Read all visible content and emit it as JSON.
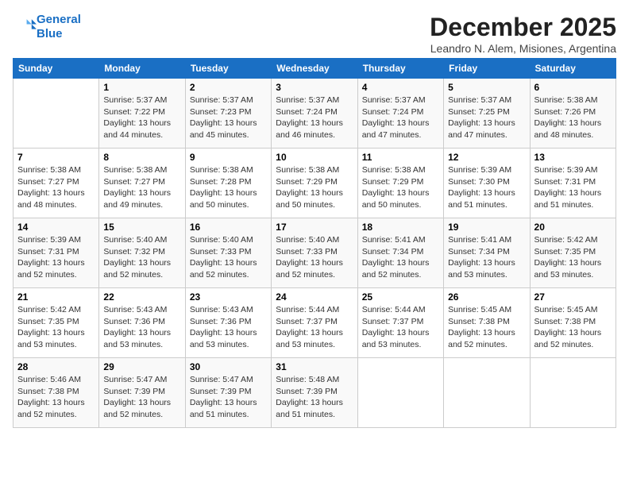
{
  "header": {
    "logo_line1": "General",
    "logo_line2": "Blue",
    "month": "December 2025",
    "location": "Leandro N. Alem, Misiones, Argentina"
  },
  "days_of_week": [
    "Sunday",
    "Monday",
    "Tuesday",
    "Wednesday",
    "Thursday",
    "Friday",
    "Saturday"
  ],
  "weeks": [
    [
      {
        "day": "",
        "content": ""
      },
      {
        "day": "1",
        "content": "Sunrise: 5:37 AM\nSunset: 7:22 PM\nDaylight: 13 hours\nand 44 minutes."
      },
      {
        "day": "2",
        "content": "Sunrise: 5:37 AM\nSunset: 7:23 PM\nDaylight: 13 hours\nand 45 minutes."
      },
      {
        "day": "3",
        "content": "Sunrise: 5:37 AM\nSunset: 7:24 PM\nDaylight: 13 hours\nand 46 minutes."
      },
      {
        "day": "4",
        "content": "Sunrise: 5:37 AM\nSunset: 7:24 PM\nDaylight: 13 hours\nand 47 minutes."
      },
      {
        "day": "5",
        "content": "Sunrise: 5:37 AM\nSunset: 7:25 PM\nDaylight: 13 hours\nand 47 minutes."
      },
      {
        "day": "6",
        "content": "Sunrise: 5:38 AM\nSunset: 7:26 PM\nDaylight: 13 hours\nand 48 minutes."
      }
    ],
    [
      {
        "day": "7",
        "content": "Sunrise: 5:38 AM\nSunset: 7:27 PM\nDaylight: 13 hours\nand 48 minutes."
      },
      {
        "day": "8",
        "content": "Sunrise: 5:38 AM\nSunset: 7:27 PM\nDaylight: 13 hours\nand 49 minutes."
      },
      {
        "day": "9",
        "content": "Sunrise: 5:38 AM\nSunset: 7:28 PM\nDaylight: 13 hours\nand 50 minutes."
      },
      {
        "day": "10",
        "content": "Sunrise: 5:38 AM\nSunset: 7:29 PM\nDaylight: 13 hours\nand 50 minutes."
      },
      {
        "day": "11",
        "content": "Sunrise: 5:38 AM\nSunset: 7:29 PM\nDaylight: 13 hours\nand 50 minutes."
      },
      {
        "day": "12",
        "content": "Sunrise: 5:39 AM\nSunset: 7:30 PM\nDaylight: 13 hours\nand 51 minutes."
      },
      {
        "day": "13",
        "content": "Sunrise: 5:39 AM\nSunset: 7:31 PM\nDaylight: 13 hours\nand 51 minutes."
      }
    ],
    [
      {
        "day": "14",
        "content": "Sunrise: 5:39 AM\nSunset: 7:31 PM\nDaylight: 13 hours\nand 52 minutes."
      },
      {
        "day": "15",
        "content": "Sunrise: 5:40 AM\nSunset: 7:32 PM\nDaylight: 13 hours\nand 52 minutes."
      },
      {
        "day": "16",
        "content": "Sunrise: 5:40 AM\nSunset: 7:33 PM\nDaylight: 13 hours\nand 52 minutes."
      },
      {
        "day": "17",
        "content": "Sunrise: 5:40 AM\nSunset: 7:33 PM\nDaylight: 13 hours\nand 52 minutes."
      },
      {
        "day": "18",
        "content": "Sunrise: 5:41 AM\nSunset: 7:34 PM\nDaylight: 13 hours\nand 52 minutes."
      },
      {
        "day": "19",
        "content": "Sunrise: 5:41 AM\nSunset: 7:34 PM\nDaylight: 13 hours\nand 53 minutes."
      },
      {
        "day": "20",
        "content": "Sunrise: 5:42 AM\nSunset: 7:35 PM\nDaylight: 13 hours\nand 53 minutes."
      }
    ],
    [
      {
        "day": "21",
        "content": "Sunrise: 5:42 AM\nSunset: 7:35 PM\nDaylight: 13 hours\nand 53 minutes."
      },
      {
        "day": "22",
        "content": "Sunrise: 5:43 AM\nSunset: 7:36 PM\nDaylight: 13 hours\nand 53 minutes."
      },
      {
        "day": "23",
        "content": "Sunrise: 5:43 AM\nSunset: 7:36 PM\nDaylight: 13 hours\nand 53 minutes."
      },
      {
        "day": "24",
        "content": "Sunrise: 5:44 AM\nSunset: 7:37 PM\nDaylight: 13 hours\nand 53 minutes."
      },
      {
        "day": "25",
        "content": "Sunrise: 5:44 AM\nSunset: 7:37 PM\nDaylight: 13 hours\nand 53 minutes."
      },
      {
        "day": "26",
        "content": "Sunrise: 5:45 AM\nSunset: 7:38 PM\nDaylight: 13 hours\nand 52 minutes."
      },
      {
        "day": "27",
        "content": "Sunrise: 5:45 AM\nSunset: 7:38 PM\nDaylight: 13 hours\nand 52 minutes."
      }
    ],
    [
      {
        "day": "28",
        "content": "Sunrise: 5:46 AM\nSunset: 7:38 PM\nDaylight: 13 hours\nand 52 minutes."
      },
      {
        "day": "29",
        "content": "Sunrise: 5:47 AM\nSunset: 7:39 PM\nDaylight: 13 hours\nand 52 minutes."
      },
      {
        "day": "30",
        "content": "Sunrise: 5:47 AM\nSunset: 7:39 PM\nDaylight: 13 hours\nand 51 minutes."
      },
      {
        "day": "31",
        "content": "Sunrise: 5:48 AM\nSunset: 7:39 PM\nDaylight: 13 hours\nand 51 minutes."
      },
      {
        "day": "",
        "content": ""
      },
      {
        "day": "",
        "content": ""
      },
      {
        "day": "",
        "content": ""
      }
    ]
  ]
}
